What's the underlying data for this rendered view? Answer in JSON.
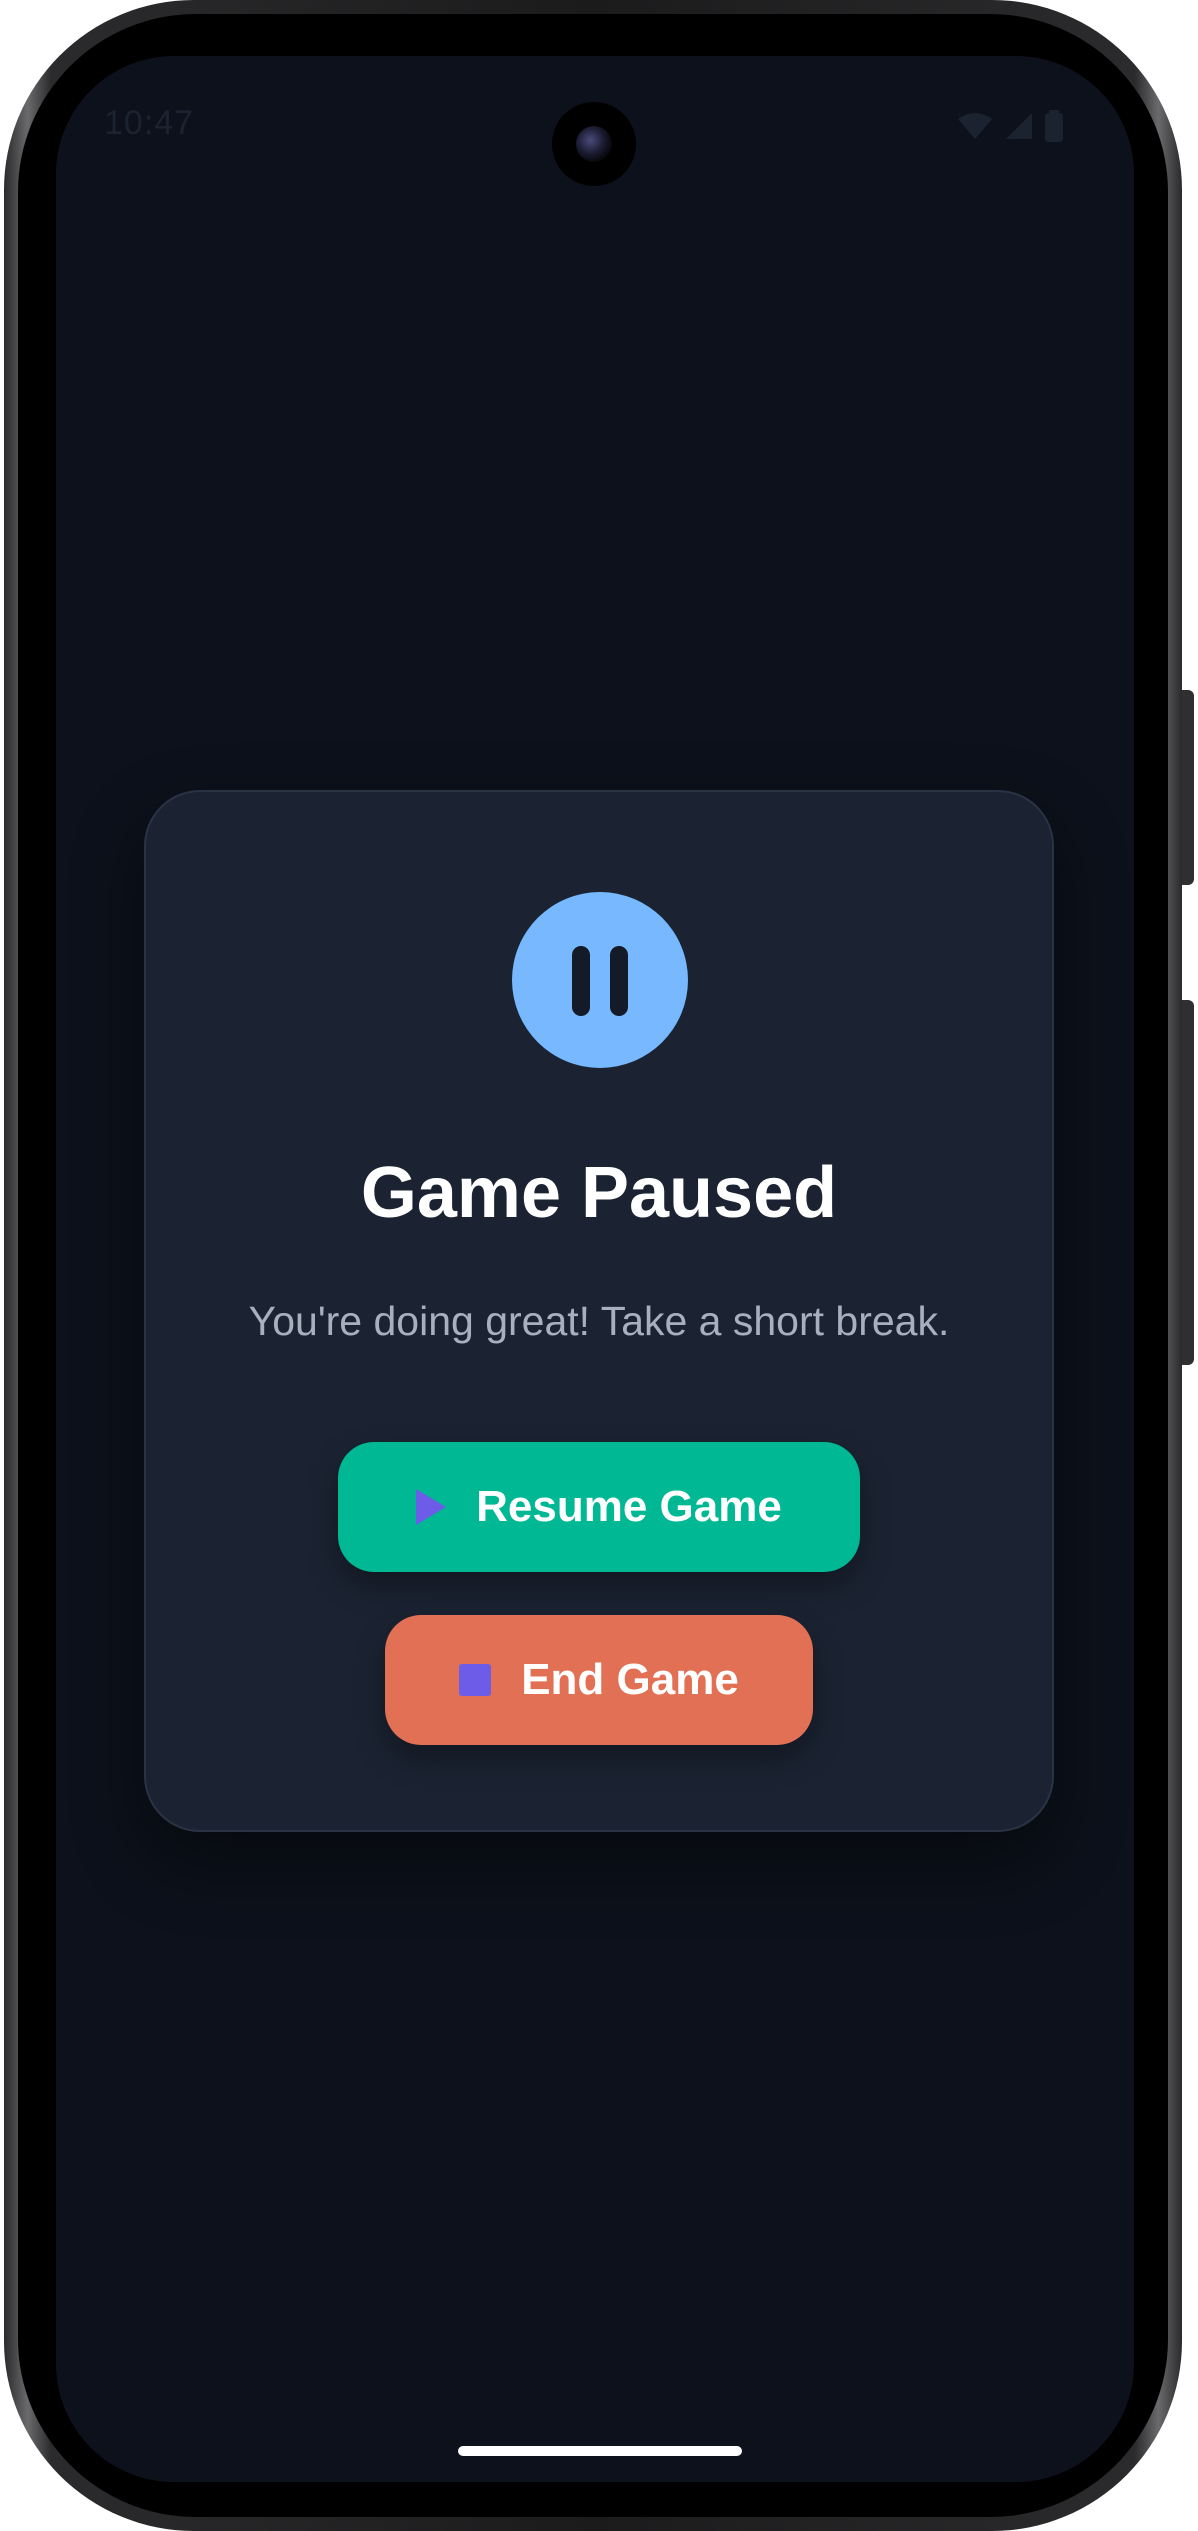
{
  "status_bar": {
    "time": "10:47",
    "icons": [
      "wifi-icon",
      "signal-icon",
      "battery-icon"
    ]
  },
  "dialog": {
    "icon": "pause-icon",
    "title": "Game Paused",
    "message": "You're doing great! Take a short break.",
    "resume_button": {
      "label": "Resume Game",
      "icon": "play-icon"
    },
    "end_button": {
      "label": "End Game",
      "icon": "stop-icon"
    }
  },
  "colors": {
    "background": "#0c111b",
    "card": "#1b2332",
    "pause_icon_bg": "#78b8ff",
    "resume": "#00b894",
    "end": "#e17055",
    "icon_accent": "#6c5ce7"
  }
}
